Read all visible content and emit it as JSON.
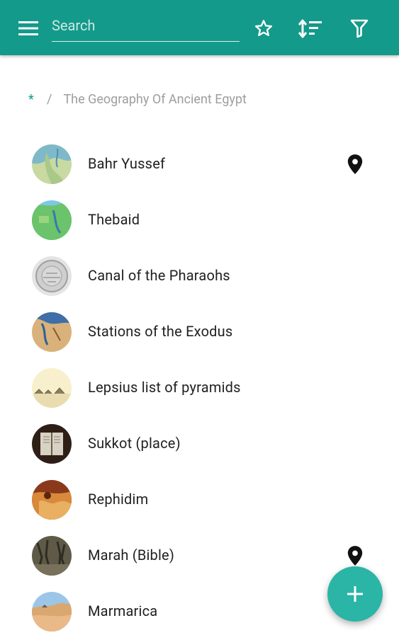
{
  "appbar": {
    "search_placeholder": "Search",
    "icons": [
      "menu-icon",
      "star-icon",
      "sort-icon",
      "filter-icon"
    ]
  },
  "breadcrumb": {
    "root": "*",
    "separator": "/",
    "current": "The Geography Of Ancient Egypt"
  },
  "items": [
    {
      "label": "Bahr Yussef",
      "has_location": true,
      "thumb_colors": [
        "#6bb0c9",
        "#c8d7a0"
      ]
    },
    {
      "label": "Thebaid",
      "has_location": false,
      "thumb_colors": [
        "#7cc6e0",
        "#6cc36a"
      ]
    },
    {
      "label": "Canal of the Pharaohs",
      "has_location": false,
      "thumb_colors": [
        "#e0e0e0",
        "#a8a8a8"
      ]
    },
    {
      "label": "Stations of the Exodus",
      "has_location": false,
      "thumb_colors": [
        "#3f6ea8",
        "#d9b277"
      ]
    },
    {
      "label": "Lepsius list of pyramids",
      "has_location": false,
      "thumb_colors": [
        "#f7efc8",
        "#b8a98a"
      ]
    },
    {
      "label": "Sukkot (place)",
      "has_location": false,
      "thumb_colors": [
        "#3b2a1f",
        "#d8d2c4"
      ]
    },
    {
      "label": "Rephidim",
      "has_location": false,
      "thumb_colors": [
        "#8a3a1a",
        "#e0a050"
      ]
    },
    {
      "label": "Marah (Bible)",
      "has_location": true,
      "thumb_colors": [
        "#6f6a55",
        "#3d3a2e"
      ]
    },
    {
      "label": "Marmarica",
      "has_location": false,
      "thumb_colors": [
        "#8fbde0",
        "#e0b07a"
      ]
    }
  ],
  "fab": {
    "icon": "plus-icon"
  },
  "colors": {
    "primary": "#139a8a",
    "fab": "#2ab5a6",
    "text": "#212121",
    "muted": "#9e9e9e"
  }
}
